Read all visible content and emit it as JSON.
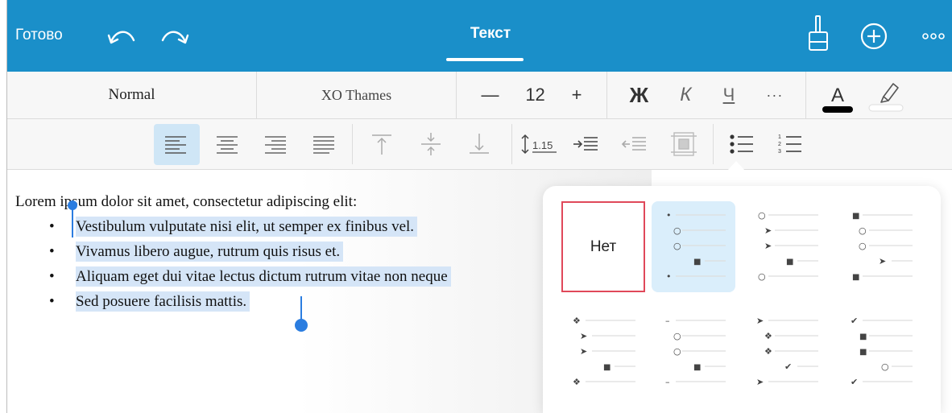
{
  "topbar": {
    "done_label": "Готово",
    "title": "Текст",
    "icons": [
      "undo-icon",
      "redo-icon",
      "format-brush-icon",
      "add-icon",
      "more-icon"
    ],
    "bg_color": "#1a8fc9"
  },
  "toolbar": {
    "style": "Normal",
    "font": "XO Thames",
    "decrease": "—",
    "size": "12",
    "increase": "+",
    "bold": "Ж",
    "italic": "К",
    "underline": "Ч",
    "more": "···",
    "font_color_letter": "A",
    "font_color": "#000000"
  },
  "paragraph_toolbar": {
    "buttons": [
      "align-left",
      "align-center",
      "align-right",
      "justify",
      "valign-top",
      "valign-middle",
      "valign-bottom",
      "line-spacing",
      "indent-increase",
      "indent-decrease",
      "cell-margins",
      "bulleted-list",
      "numbered-list"
    ],
    "active": "align-left",
    "line_spacing_value": "1.15"
  },
  "document": {
    "intro": "Lorem ipsum dolor sit amet, consectetur adipiscing elit:",
    "bullet": "•",
    "items": [
      "Vestibulum vulputate nisi elit, ut semper ex finibus vel.",
      "Vivamus libero augue, rutrum quis risus et.",
      "Aliquam eget dui vitae lectus dictum rutrum vitae non neque",
      "Sed posuere facilisis mattis."
    ],
    "selection_color": "#d5e5f7"
  },
  "bullet_picker": {
    "none_label": "Нет",
    "selected_index": 1,
    "options": [
      {
        "marks": []
      },
      {
        "marks": [
          "•",
          "○",
          "○",
          "■",
          "•"
        ]
      },
      {
        "marks": [
          "○",
          "➤",
          "➤",
          "■",
          "○"
        ]
      },
      {
        "marks": [
          "■",
          "○",
          "○",
          "➤",
          "■"
        ]
      },
      {
        "marks": [
          "❖",
          "➤",
          "➤",
          "■",
          "❖"
        ]
      },
      {
        "marks": [
          "–",
          "○",
          "○",
          "■",
          "–"
        ]
      },
      {
        "marks": [
          "➤",
          "❖",
          "❖",
          "✔",
          "➤"
        ]
      },
      {
        "marks": [
          "✔",
          "■",
          "■",
          "○",
          "✔"
        ]
      }
    ]
  }
}
